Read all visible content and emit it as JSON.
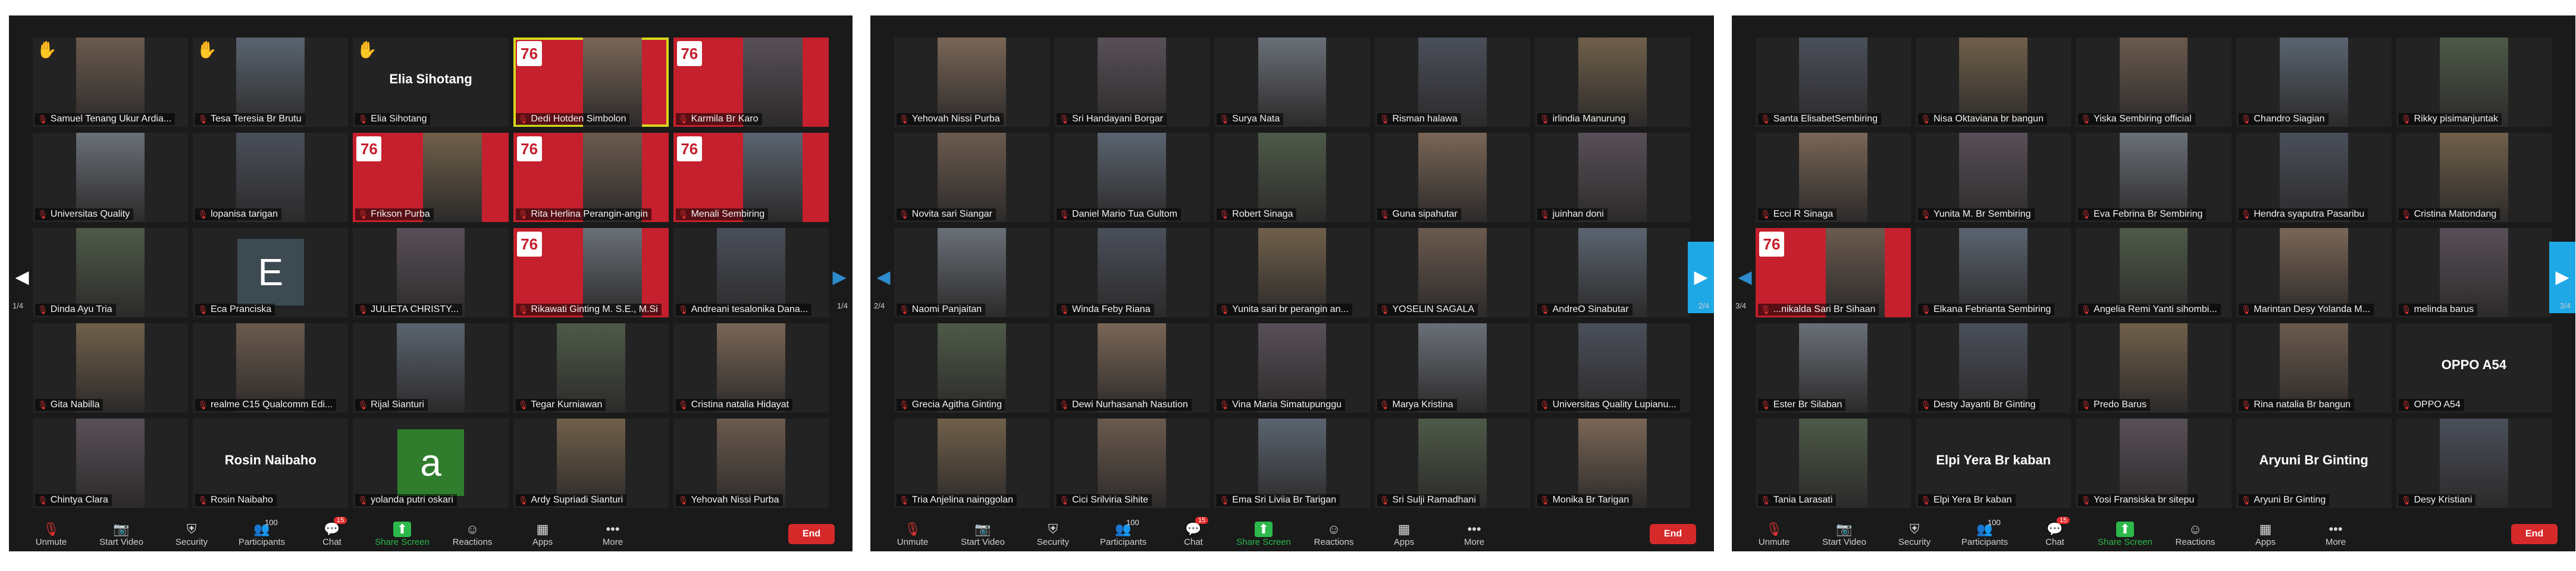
{
  "toolbar": {
    "unmute": "Unmute",
    "start_video": "Start Video",
    "security": "Security",
    "participants": "Participants",
    "participants_count": "100",
    "chat": "Chat",
    "chat_badge": "15",
    "share_screen": "Share Screen",
    "reactions": "Reactions",
    "apps": "Apps",
    "more": "More",
    "end": "End"
  },
  "icons": [
    "mic-muted-icon",
    "video-off-icon",
    "shield-icon",
    "participants-icon",
    "chat-icon",
    "share-screen-icon",
    "reactions-icon",
    "apps-icon",
    "more-icon",
    "raised-hand-icon",
    "page-arrow-icon"
  ],
  "colors": {
    "accent_blue": "#1fa8e6",
    "share_green": "#2db84b",
    "end_red": "#d62a2a",
    "banner_red": "#c5202d",
    "active_yellow": "#d6d61e"
  },
  "panels": [
    {
      "page_left": "1/4",
      "page_right": "1/4",
      "tiles": [
        {
          "name": "Samuel Tenang Ukur Ardia...",
          "hand": true
        },
        {
          "name": "Tesa Teresia Br Brutu",
          "hand": true
        },
        {
          "name": "Elia Sihotang",
          "hand": true,
          "display": "Elia Sihotang"
        },
        {
          "name": "Dedi Hotden Simbolon",
          "banner": true,
          "active": true
        },
        {
          "name": "Karmila Br Karo",
          "banner": true
        },
        {
          "name": "Universitas Quality"
        },
        {
          "name": "lopanisa tarigan"
        },
        {
          "name": "Frikson Purba",
          "banner": true
        },
        {
          "name": "Rita Herlina Perangin-angin",
          "banner": true
        },
        {
          "name": "Menali Sembiring",
          "banner": true
        },
        {
          "name": "Dinda Ayu Tria"
        },
        {
          "name": "Eca Pranciska",
          "avatar": "E",
          "avatarColor": "#3d4a52"
        },
        {
          "name": "JULIETA CHRISTY..."
        },
        {
          "name": "Rikawati Ginting M. S.E., M.Si",
          "banner": true
        },
        {
          "name": "Andreani tesalonika Dana..."
        },
        {
          "name": "Gita Nabilla"
        },
        {
          "name": "realme C15 Qualcomm Edi..."
        },
        {
          "name": "Rijal Sianturi"
        },
        {
          "name": "Tegar Kurniawan"
        },
        {
          "name": "Cristina natalia Hidayat"
        },
        {
          "name": "Chintya Clara"
        },
        {
          "name": "Rosin Naibaho",
          "display": "Rosin Naibaho"
        },
        {
          "name": "yolanda putri oskari",
          "avatar": "a",
          "avatarColor": "#2f7d2d"
        },
        {
          "name": "Ardy Supriadi Sianturi"
        },
        {
          "name": "Yehovah Nissi Purba"
        }
      ]
    },
    {
      "page_left": "2/4",
      "page_right": "2/4",
      "tiles": [
        {
          "name": "Yehovah Nissi Purba"
        },
        {
          "name": "Sri Handayani Borgar"
        },
        {
          "name": "Surya Nata"
        },
        {
          "name": "Risman halawa"
        },
        {
          "name": "irlindia Manurung"
        },
        {
          "name": "Novita sari Siangar"
        },
        {
          "name": "Daniel Mario Tua Gultom"
        },
        {
          "name": "Robert Sinaga"
        },
        {
          "name": "Guna sipahutar"
        },
        {
          "name": "juinhan doni"
        },
        {
          "name": "Naomi Panjaitan"
        },
        {
          "name": "Winda Feby Riana"
        },
        {
          "name": "Yunita sari br perangin an..."
        },
        {
          "name": "YOSELIN SAGALA"
        },
        {
          "name": "AndreO Sinabutar"
        },
        {
          "name": "Grecia Agitha Ginting"
        },
        {
          "name": "Dewi Nurhasanah Nasution"
        },
        {
          "name": "Vina Maria Simatupunggu"
        },
        {
          "name": "Marya Kristina"
        },
        {
          "name": "Universitas Quality Lupianu..."
        },
        {
          "name": "Tria Anjelina nainggolan"
        },
        {
          "name": "Cici Srilviria Sihite"
        },
        {
          "name": "Ema Sri Liviia Br Tarigan"
        },
        {
          "name": "Sri Sulji Ramadhani"
        },
        {
          "name": "Monika Br Tarigan"
        }
      ]
    },
    {
      "page_left": "3/4",
      "page_right": "3/4",
      "tiles": [
        {
          "name": "Santa ElisabetSembiring"
        },
        {
          "name": "Nisa Oktaviana br bangun"
        },
        {
          "name": "Yiska Sembiring official"
        },
        {
          "name": "Chandro Siagian"
        },
        {
          "name": "Rikky pisimanjuntak"
        },
        {
          "name": "Ecci R Sinaga"
        },
        {
          "name": "Yunita M. Br Sembiring"
        },
        {
          "name": "Eva Febrina Br Sembiring"
        },
        {
          "name": "Hendra syaputra Pasaribu"
        },
        {
          "name": "Cristina Matondang"
        },
        {
          "name": "...nikalda Sari Br Sihaan",
          "banner": true
        },
        {
          "name": "Elkana Febrianta Sembiring"
        },
        {
          "name": "Angelia Remi Yanti sihombi..."
        },
        {
          "name": "Marintan Desy Yolanda M..."
        },
        {
          "name": "melinda barus"
        },
        {
          "name": "Ester Br Silaban"
        },
        {
          "name": "Desty Jayanti Br Ginting"
        },
        {
          "name": "Predo Barus"
        },
        {
          "name": "Rina natalia Br bangun"
        },
        {
          "name": "OPPO A54",
          "display": "OPPO A54"
        },
        {
          "name": "Tania Larasati"
        },
        {
          "name": "Elpi Yera Br kaban",
          "display": "Elpi Yera Br kaban"
        },
        {
          "name": "Yosi Fransiska br sitepu"
        },
        {
          "name": "Aryuni Br Ginting",
          "display": "Aryuni Br Ginting"
        },
        {
          "name": "Desy Kristiani"
        }
      ]
    }
  ]
}
